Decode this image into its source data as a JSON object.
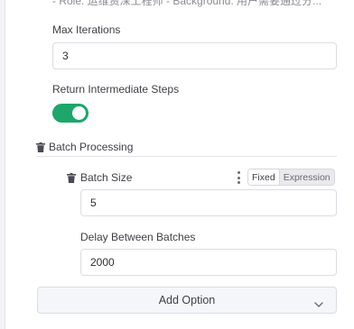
{
  "truncated_line": "- Role: 运维资深工程师 - Background: 用户需要通过分...",
  "max_iterations": {
    "label": "Max Iterations",
    "value": "3"
  },
  "return_intermediate": {
    "label": "Return Intermediate Steps",
    "enabled": true
  },
  "batch_processing": {
    "title": "Batch Processing",
    "batch_size": {
      "label": "Batch Size",
      "value": "5",
      "mode_options": [
        "Fixed",
        "Expression"
      ],
      "selected_mode": "Fixed"
    },
    "delay": {
      "label": "Delay Between Batches",
      "value": "2000"
    }
  },
  "add_option": {
    "label": "Add Option"
  },
  "colors": {
    "toggle_on": "#1ea66b"
  }
}
